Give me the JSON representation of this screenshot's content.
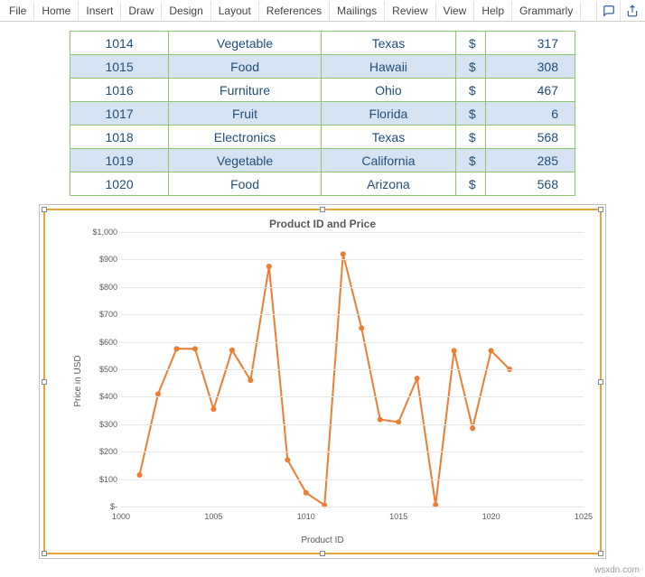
{
  "ribbon": {
    "tabs": [
      "File",
      "Home",
      "Insert",
      "Draw",
      "Design",
      "Layout",
      "References",
      "Mailings",
      "Review",
      "View",
      "Help",
      "Grammarly"
    ]
  },
  "table": {
    "currency": "$",
    "rows": [
      {
        "id": "1014",
        "cat": "Vegetable",
        "state": "Texas",
        "val": "317",
        "band": false
      },
      {
        "id": "1015",
        "cat": "Food",
        "state": "Hawaii",
        "val": "308",
        "band": true
      },
      {
        "id": "1016",
        "cat": "Furniture",
        "state": "Ohio",
        "val": "467",
        "band": false
      },
      {
        "id": "1017",
        "cat": "Fruit",
        "state": "Florida",
        "val": "6",
        "band": true
      },
      {
        "id": "1018",
        "cat": "Electronics",
        "state": "Texas",
        "val": "568",
        "band": false
      },
      {
        "id": "1019",
        "cat": "Vegetable",
        "state": "California",
        "val": "285",
        "band": true
      },
      {
        "id": "1020",
        "cat": "Food",
        "state": "Arizona",
        "val": "568",
        "band": false
      }
    ]
  },
  "chart_data": {
    "type": "line",
    "title": "Product ID and Price",
    "xlabel": "Product ID",
    "ylabel": "Price in USD",
    "xlim": [
      1000,
      1025
    ],
    "ylim": [
      0,
      1000
    ],
    "yticks": [
      0,
      100,
      200,
      300,
      400,
      500,
      600,
      700,
      800,
      900,
      1000
    ],
    "yticklabels": [
      "$-",
      "$100",
      "$200",
      "$300",
      "$400",
      "$500",
      "$600",
      "$700",
      "$800",
      "$900",
      "$1,000"
    ],
    "xticks": [
      1000,
      1005,
      1010,
      1015,
      1020,
      1025
    ],
    "series": [
      {
        "name": "Price",
        "color": "#ed7d31",
        "x": [
          1001,
          1002,
          1003,
          1004,
          1005,
          1006,
          1007,
          1008,
          1009,
          1010,
          1011,
          1012,
          1013,
          1014,
          1015,
          1016,
          1017,
          1018,
          1019,
          1020,
          1021
        ],
        "y": [
          115,
          410,
          575,
          575,
          355,
          570,
          460,
          875,
          170,
          50,
          5,
          920,
          650,
          317,
          308,
          467,
          6,
          568,
          285,
          568,
          500
        ]
      }
    ]
  },
  "watermark": "wsxdn.com"
}
